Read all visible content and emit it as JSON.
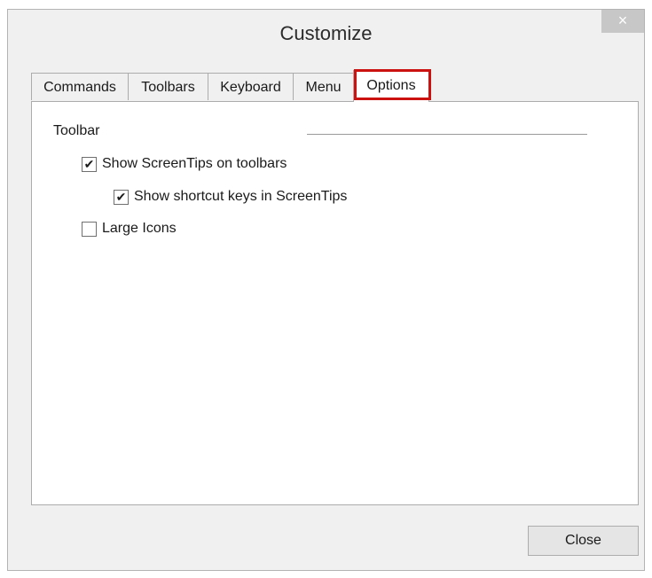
{
  "window": {
    "title": "Customize",
    "close_glyph": "×"
  },
  "tabs": [
    {
      "label": "Commands",
      "active": false
    },
    {
      "label": "Toolbars",
      "active": false
    },
    {
      "label": "Keyboard",
      "active": false
    },
    {
      "label": "Menu",
      "active": false
    },
    {
      "label": "Options",
      "active": true
    }
  ],
  "options": {
    "group_label": "Toolbar",
    "checkboxes": [
      {
        "label": "Show ScreenTips on toolbars",
        "checked": true,
        "glyph": "✔"
      },
      {
        "label": "Show shortcut keys in ScreenTips",
        "checked": true,
        "glyph": "✔"
      },
      {
        "label": "Large Icons",
        "checked": false,
        "glyph": ""
      }
    ]
  },
  "footer": {
    "close_label": "Close"
  },
  "colors": {
    "highlight": "#cc1111",
    "dialog_bg": "#f0f0f0",
    "panel_bg": "#ffffff"
  }
}
